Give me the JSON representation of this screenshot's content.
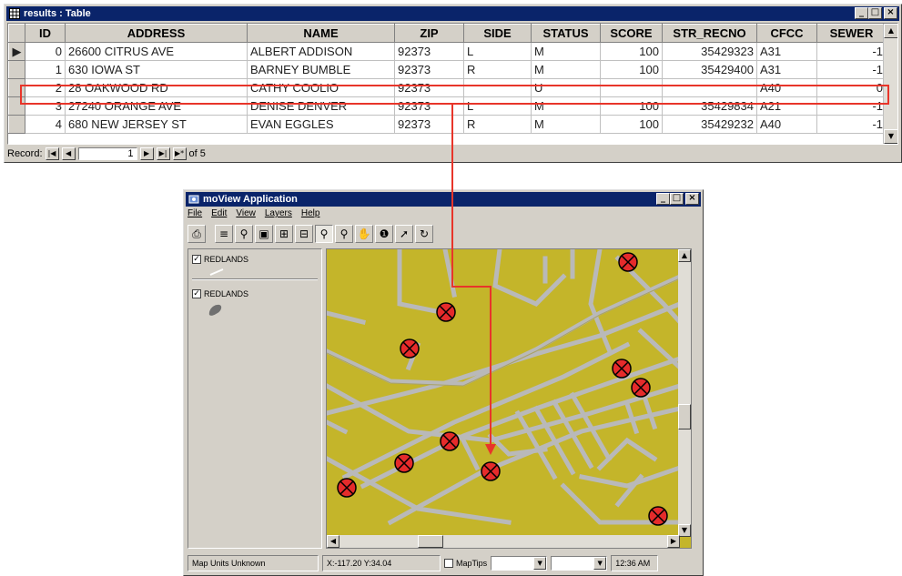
{
  "table_window": {
    "title": "results : Table",
    "columns": [
      "ID",
      "ADDRESS",
      "NAME",
      "ZIP",
      "SIDE",
      "STATUS",
      "SCORE",
      "STR_RECNO",
      "CFCC",
      "SEWER"
    ],
    "rows": [
      {
        "id": "0",
        "address": "26600 CITRUS AVE",
        "name": "ALBERT ADDISON",
        "zip": "92373",
        "side": "L",
        "status": "M",
        "score": "100",
        "str_recno": "35429323",
        "cfcc": "A31",
        "sewer": "-1"
      },
      {
        "id": "1",
        "address": "630 IOWA ST",
        "name": "BARNEY BUMBLE",
        "zip": "92373",
        "side": "R",
        "status": "M",
        "score": "100",
        "str_recno": "35429400",
        "cfcc": "A31",
        "sewer": "-1"
      },
      {
        "id": "2",
        "address": "28 OAKWOOD RD",
        "name": "CATHY COOLIO",
        "zip": "92373",
        "side": "",
        "status": "U",
        "score": "",
        "str_recno": "",
        "cfcc": "A40",
        "sewer": "0"
      },
      {
        "id": "3",
        "address": "27240 ORANGE AVE",
        "name": "DENISE DENVER",
        "zip": "92373",
        "side": "L",
        "status": "M",
        "score": "100",
        "str_recno": "35429834",
        "cfcc": "A21",
        "sewer": "-1"
      },
      {
        "id": "4",
        "address": "680 NEW JERSEY ST",
        "name": "EVAN EGGLES",
        "zip": "92373",
        "side": "R",
        "status": "M",
        "score": "100",
        "str_recno": "35429232",
        "cfcc": "A40",
        "sewer": "-1"
      }
    ],
    "record_label": "Record:",
    "record_value": "1",
    "record_of": "of 5",
    "highlight_color": "#e8352a"
  },
  "map_window": {
    "title": "moView Application",
    "menu": [
      "File",
      "Edit",
      "View",
      "Layers",
      "Help"
    ],
    "tools": [
      "print-icon",
      "layers-icon",
      "find-icon",
      "extent-icon",
      "add-layer-icon",
      "remove-layer-icon",
      "zoom-in-icon",
      "zoom-out-icon",
      "pan-icon",
      "identify-icon",
      "select-icon",
      "refresh-icon"
    ],
    "layers": [
      {
        "label": "REDLANDS",
        "checked": true
      },
      {
        "label": "REDLANDS",
        "checked": true
      }
    ],
    "map_color": "#c4b52a",
    "status": {
      "units": "Map Units Unknown",
      "coords": "X:-117.20 Y:34.04",
      "maptips_label": "MapTips",
      "time": "12:36 AM"
    }
  }
}
